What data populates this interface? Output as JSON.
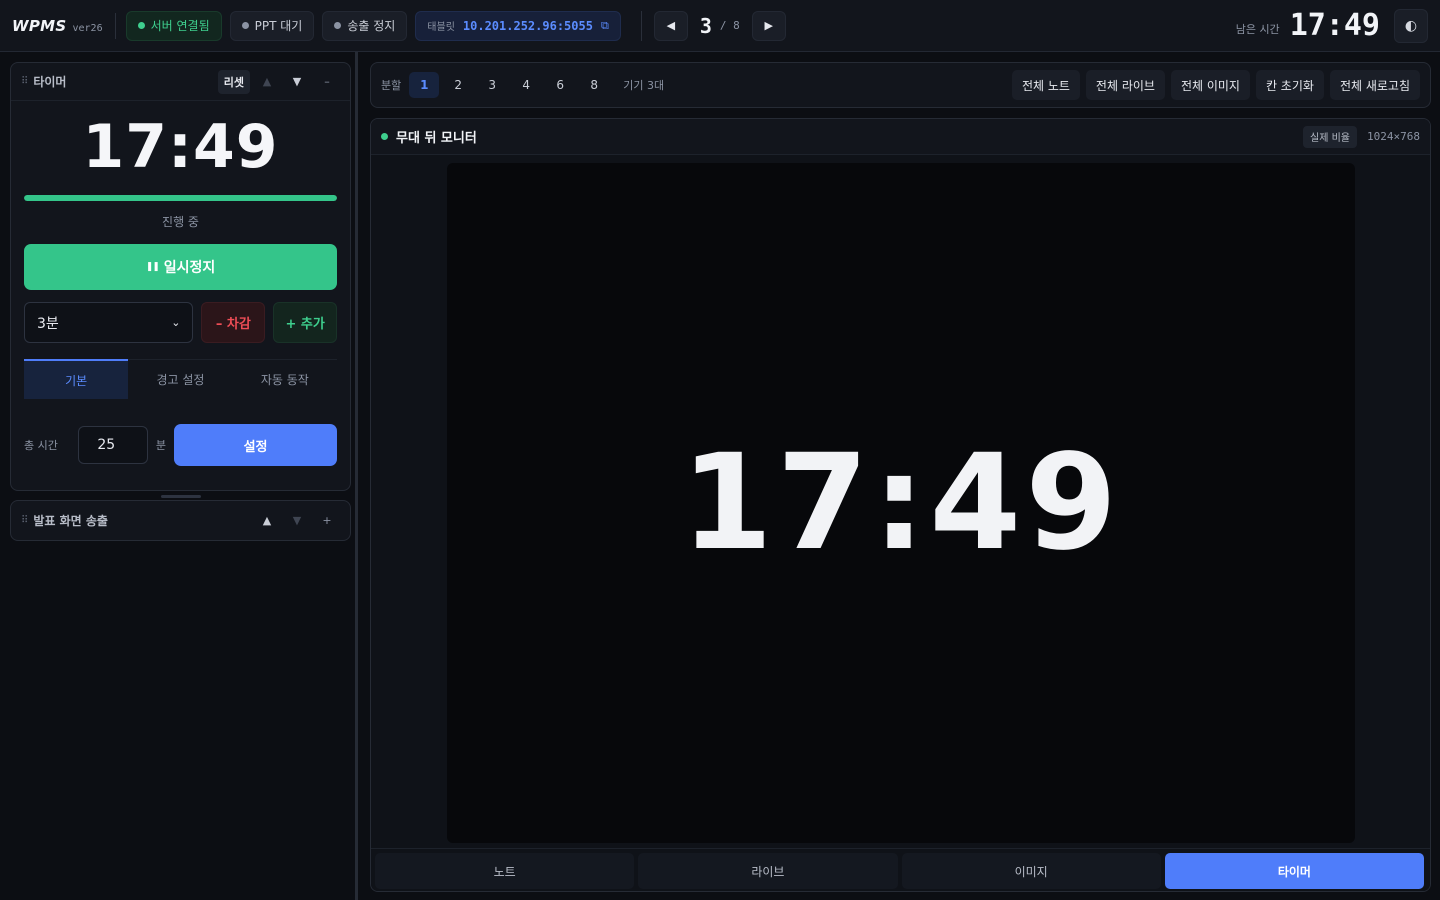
{
  "app": {
    "name": "WPMS",
    "version": "ver26"
  },
  "header": {
    "status_pills": [
      {
        "label": "서버 연결됨",
        "dot_color": "#3ecf8e"
      },
      {
        "label": "PPT 대기",
        "dot_color": "#8b93a3"
      },
      {
        "label": "송출 정지",
        "dot_color": "#8b93a3"
      }
    ],
    "tablet": {
      "label": "태블릿",
      "address": "10.201.252.96:5055",
      "copy_icon": "copy-icon"
    },
    "slide": {
      "prev_icon": "◀",
      "next_icon": "▶",
      "current": "3",
      "total": "/ 8"
    },
    "remaining": {
      "label": "남은 시간",
      "value": "17:49"
    },
    "theme_icon": "◐"
  },
  "timer_card": {
    "title": "타이머",
    "reset_label": "리셋",
    "up_icon": "▲",
    "down_icon": "▼",
    "collapse_icon": "–",
    "time": "17:49",
    "progress": 1.0,
    "status": "진행 중",
    "pause_label": "일시정지",
    "pause_icon": "❚❚",
    "step_value": "3분",
    "minus_label": "– 차감",
    "plus_label": "+ 추가",
    "tabs": [
      "기본",
      "경고 설정",
      "자동 동작"
    ],
    "total_label": "총 시간",
    "total_value": "25",
    "unit": "분",
    "set_label": "설정"
  },
  "broadcast_card": {
    "title": "발표 화면 송출",
    "up_icon": "▲",
    "down_icon": "▼",
    "expand_icon": "+"
  },
  "toolbar": {
    "split_label": "분할",
    "split_options": [
      "1",
      "2",
      "3",
      "4",
      "6",
      "8"
    ],
    "split_active": "1",
    "device_count": "기기 3대",
    "actions": [
      "전체 노트",
      "전체 라이브",
      "전체 이미지",
      "칸 초기화",
      "전체 새로고침"
    ]
  },
  "monitor": {
    "title": "무대 뒤 모니터",
    "live_color": "#3ecf8e",
    "ratio_label": "실제 비율",
    "resolution": "1024×768",
    "screen_time": "17:49",
    "modes": [
      "노트",
      "라이브",
      "이미지",
      "타이머"
    ],
    "active_mode": "타이머"
  }
}
